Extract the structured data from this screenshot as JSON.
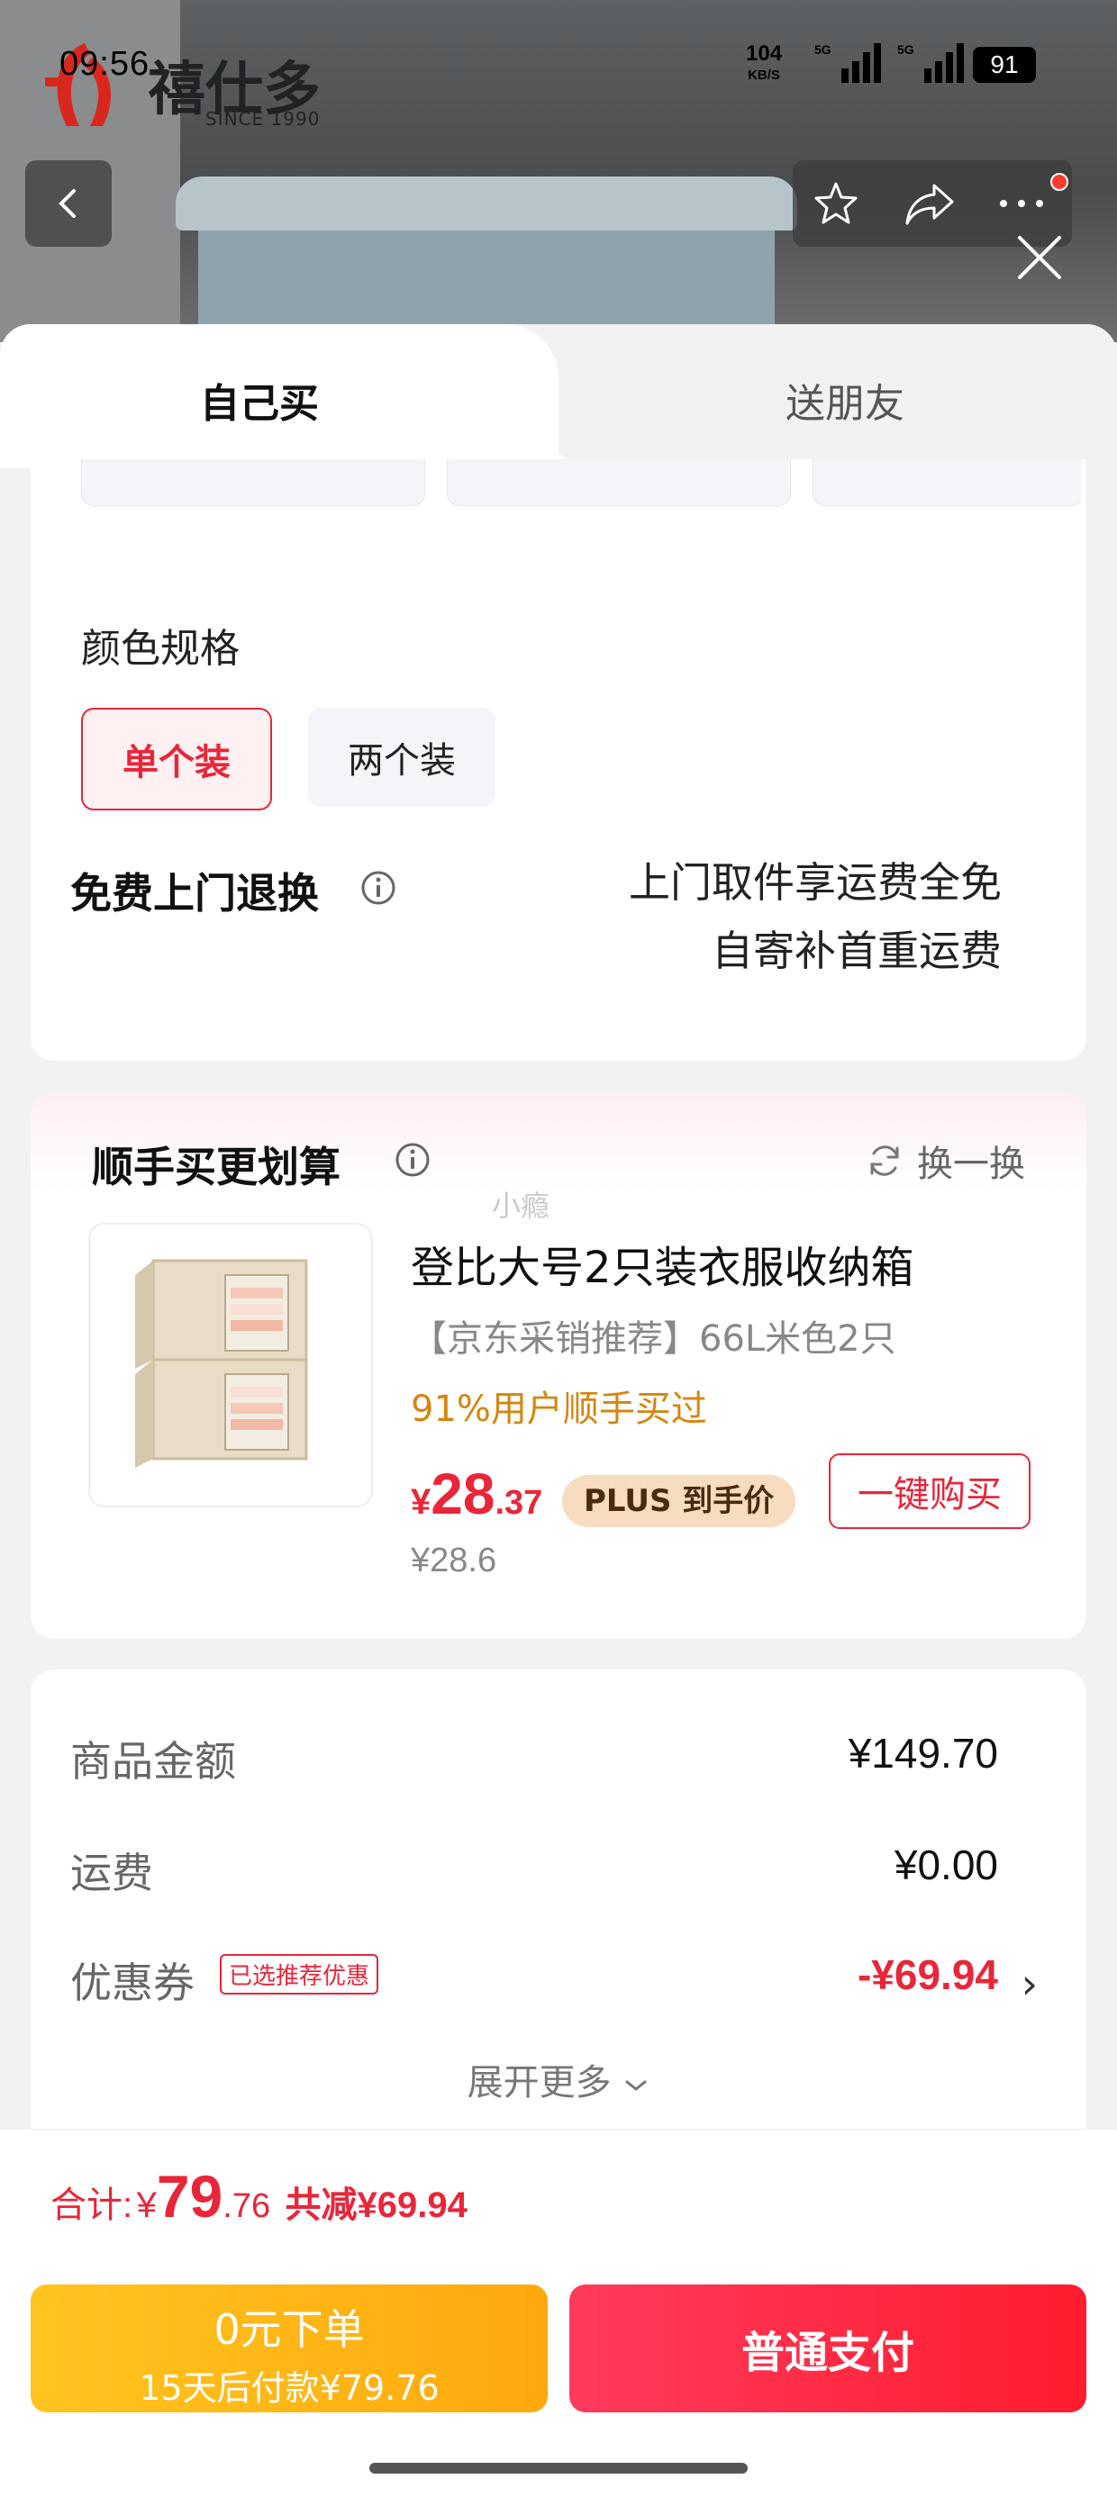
{
  "status_bar": {
    "time": "09:56",
    "net_speed_value": "104",
    "net_speed_unit": "KB/S",
    "signal_1_label": "5G",
    "signal_2_label": "5G",
    "battery": "91"
  },
  "brand": {
    "name": "禧仕多",
    "since": "SINCE 1990"
  },
  "tabs": [
    {
      "label": "自己买",
      "selected": true
    },
    {
      "label": "送朋友",
      "selected": false
    }
  ],
  "spec": {
    "section_label": "颜色规格",
    "options": [
      {
        "label": "单个装",
        "selected": true
      },
      {
        "label": "两个装",
        "selected": false
      }
    ]
  },
  "return_service": {
    "title": "免费上门退换",
    "line1": "上门取件享运费全免",
    "line2": "自寄补首重运费"
  },
  "addon": {
    "title": "顺手买更划算",
    "swap_label": "换一换",
    "watermark": "小瘾",
    "product": {
      "name": "登比大号2只装衣服收纳箱",
      "subtitle": "【京东采销推荐】66L米色2只",
      "social": "91%用户顺手买过",
      "price_currency": "¥",
      "price_int": "28",
      "price_dec": ".37",
      "plus_label": "PLUS 到手价",
      "original_price": "¥28.6",
      "buy_button": "一键购买"
    }
  },
  "summary": {
    "rows": [
      {
        "label": "商品金额",
        "value": "¥149.70"
      },
      {
        "label": "运费",
        "value": "¥0.00"
      },
      {
        "label": "优惠券",
        "value": "-¥69.94",
        "tag": "已选推荐优惠"
      }
    ],
    "expand_label": "展开更多"
  },
  "bottom": {
    "total_label": "合计:",
    "total_currency": "¥",
    "total_int": "79",
    "total_dec": ".76",
    "saved": "共减¥69.94",
    "btn_zero_line1": "0元下单",
    "btn_zero_line2": "15天后付款¥79.76",
    "btn_pay": "普通支付"
  },
  "colors": {
    "accent_red": "#e8263a",
    "orange": "#ffa80d",
    "gold_text": "#d4860f"
  }
}
